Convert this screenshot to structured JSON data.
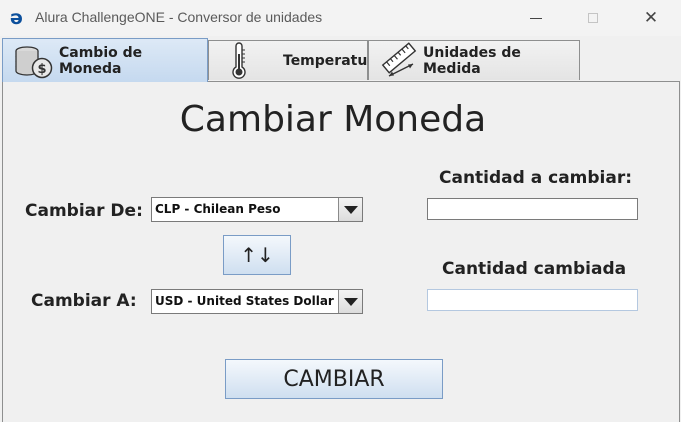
{
  "window": {
    "title": "Alura ChallengeONE - Conversor de unidades",
    "app_icon_glyph": "ə",
    "close_glyph": "✕"
  },
  "tabs": [
    {
      "label": "Cambio de Moneda",
      "icon": "coins-icon",
      "selected": true
    },
    {
      "label": "Temperatura",
      "icon": "thermometer-icon",
      "selected": false
    },
    {
      "label": "Unidades de Medida",
      "icon": "ruler-icon",
      "selected": false
    }
  ],
  "currency": {
    "heading": "Cambiar Moneda",
    "from_label": "Cambiar De:",
    "to_label": "Cambiar A:",
    "from_selected": "CLP - Chilean Peso",
    "to_selected": "USD - United States Dollar",
    "swap_glyph": "↑↓",
    "amount_label": "Cantidad a cambiar:",
    "amount_value": "",
    "result_label": "Cantidad cambiada",
    "result_value": "",
    "convert_button": "CAMBIAR"
  },
  "colors": {
    "active_tab": "#c5d9ef",
    "button_gradient_end": "#cfdff0",
    "border_blue": "#7a9cc6",
    "app_icon": "#0b4f9c"
  }
}
